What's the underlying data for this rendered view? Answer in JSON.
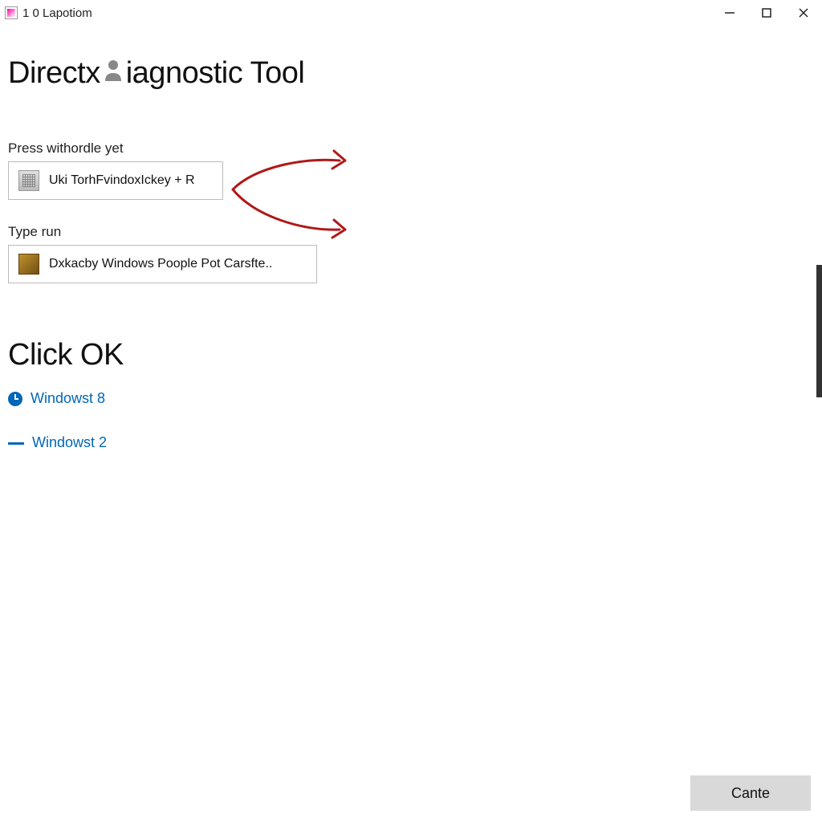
{
  "titlebar": {
    "title": "1 0 Lapotiom"
  },
  "main_title_part1": "Directx ",
  "main_title_part2": "iagnostic Tool",
  "section1": {
    "label": "Press withordle yet",
    "box_text": "Uki TorhFvindoxIckey + R"
  },
  "section2": {
    "label": "Type run",
    "box_text": "Dxkacby Windows Poople Pot Carsfte.."
  },
  "click_ok_heading": "Click OK",
  "links": {
    "item1": "Windowst 8",
    "item2": "Windowst 2"
  },
  "bottom_button": {
    "label": "Cante"
  }
}
